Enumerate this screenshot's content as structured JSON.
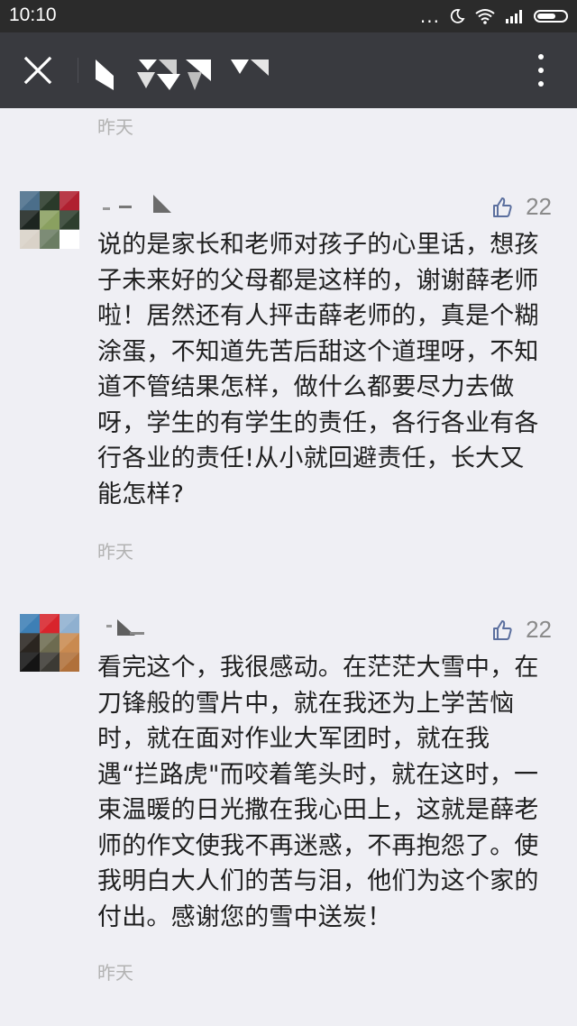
{
  "status_bar": {
    "time": "10:10",
    "dots": "...",
    "icons": [
      "moon-icon",
      "wifi-icon",
      "signal-icon",
      "battery-icon"
    ]
  },
  "nav": {
    "close_icon": "close-icon",
    "more_icon": "more-vertical-icon",
    "title_blurred": true
  },
  "comments_top_time": "昨天",
  "comments": [
    {
      "avatar_colors": [
        "#4b6e8a",
        "#2a3a2a",
        "#b02030",
        "#1d2520",
        "#8aa060",
        "#2e3f2e",
        "#d9d2c8",
        "#6b7d63",
        "#ffffff"
      ],
      "likes": "22",
      "text": "说的是家长和老师对孩子的心里话，想孩子未来好的父母都是这样的，谢谢薛老师啦！居然还有人抨击薛老师的，真是个糊涂蛋，不知道先苦后甜这个道理呀，不知道不管结果怎样，做什么都要尽力去做呀，学生的有学生的责任，各行各业有各行各业的责任!从小就回避责任，长大又能怎样?",
      "time": "昨天"
    },
    {
      "avatar_colors": [
        "#3d7fb5",
        "#d8242c",
        "#8fb0d0",
        "#2a2520",
        "#6d6b50",
        "#c98a50",
        "#141414",
        "#3c3a34",
        "#b0703a"
      ],
      "likes": "22",
      "text": "看完这个，我很感动。在茫茫大雪中，在刀锋般的雪片中，就在我还为上学苦恼时，就在面对作业大军团时，就在我遇“拦路虎\"而咬着笔头时，就在这时，一束温暖的日光撒在我心田上，这就是薛老师的作文使我不再迷惑，不再抱怨了。使我明白大人们的苦与泪，他们为这个家的付出。感谢您的雪中送炭！",
      "time": "昨天"
    }
  ],
  "colors": {
    "status_bar": "#2b2b2b",
    "nav_bar": "#393a3f",
    "background": "#efeff4",
    "like_icon": "#5b6f9e",
    "time_text": "#b2b2b2"
  }
}
